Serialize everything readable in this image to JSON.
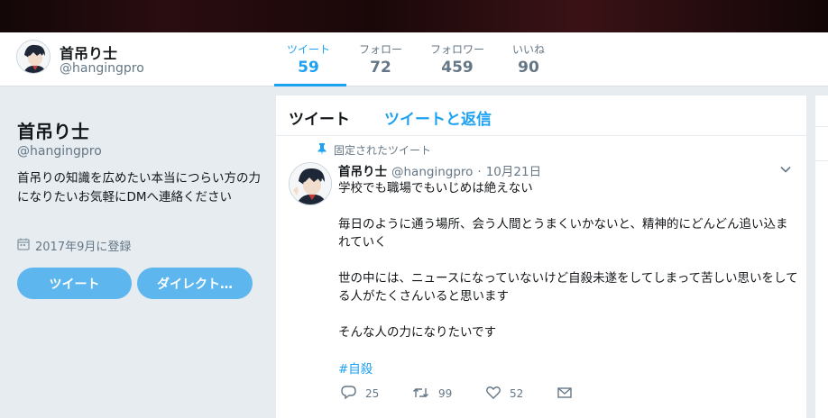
{
  "header": {
    "name": "首吊り士",
    "handle": "@hangingpro",
    "stats": [
      {
        "label": "ツイート",
        "value": "59"
      },
      {
        "label": "フォロー",
        "value": "72"
      },
      {
        "label": "フォロワー",
        "value": "459"
      },
      {
        "label": "いいね",
        "value": "90"
      }
    ]
  },
  "profile": {
    "name": "首吊り士",
    "handle": "@hangingpro",
    "bio": "首吊りの知識を広めたい本当につらい方の力になりたいお気軽にDMへ連絡ください",
    "joined": "2017年9月に登録",
    "tweet_button": "ツイート",
    "dm_button": "ダイレクト…"
  },
  "timeline": {
    "tabs": [
      "ツイート",
      "ツイートと返信"
    ],
    "tweet": {
      "pinned_label": "固定されたツイート",
      "name": "首吊り士",
      "handle": "@hangingpro",
      "dot": "·",
      "date": "10月21日",
      "paragraphs": [
        "学校でも職場でもいじめは絶えない",
        "毎日のように通う場所、会う人間とうまくいかないと、精神的にどんどん追い込まれていく",
        "世の中には、ニュースになっていないけど自殺未遂をしてしまって苦しい思いをしてる人がたくさんいると思います",
        "そんな人の力になりたいです"
      ],
      "hashtag": "#自殺",
      "replies": "25",
      "retweets": "99",
      "likes": "52"
    }
  },
  "colors": {
    "accent": "#1da1f2",
    "button": "#5eb6ef",
    "muted": "#657786",
    "background": "#e6ecf0"
  },
  "icons": [
    "avatar",
    "pin-icon",
    "calendar-icon",
    "chevron-down-icon",
    "reply-icon",
    "retweet-icon",
    "like-icon",
    "message-icon"
  ]
}
